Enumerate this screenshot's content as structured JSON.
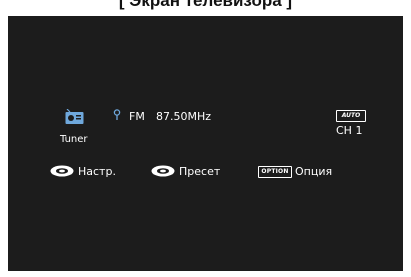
{
  "caption": "[ Экран телевизора ]",
  "tuner": {
    "label": "Tuner",
    "band": "FM",
    "frequency": "87.50MHz",
    "mode_badge": "AUTO",
    "channel": "CH 1"
  },
  "controls": {
    "setup_label": "Настр.",
    "preset_label": "Пресет",
    "option_key": "OPTION",
    "option_label": "Опция"
  },
  "colors": {
    "screen_bg": "#1c1c1c",
    "text": "#ffffff",
    "tuner_icon": "#6fa8dc"
  }
}
